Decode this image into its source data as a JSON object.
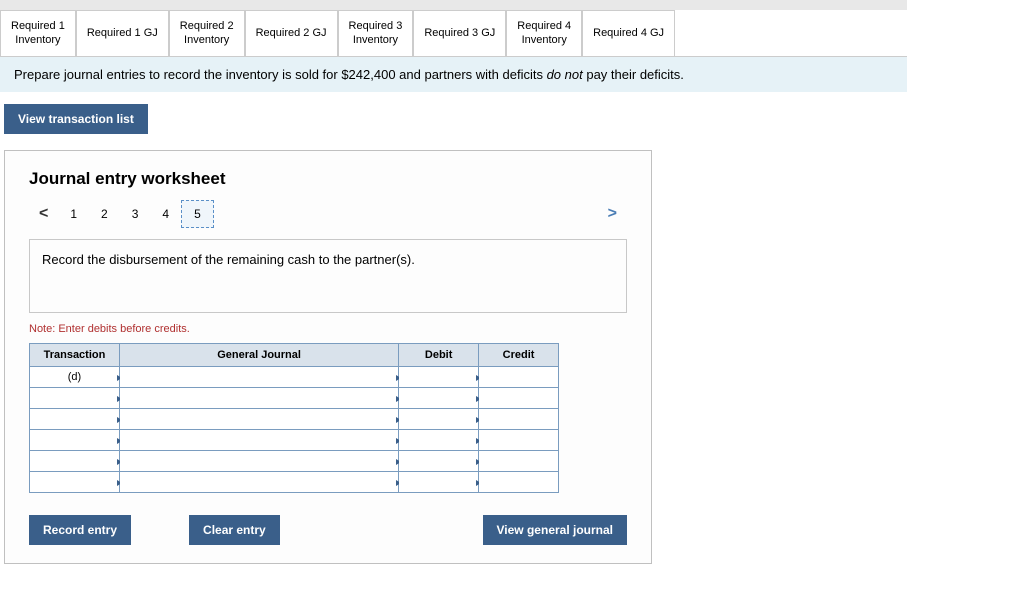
{
  "tabs": [
    {
      "line1": "Required 1",
      "line2": "Inventory"
    },
    {
      "label": "Required 1 GJ"
    },
    {
      "line1": "Required 2",
      "line2": "Inventory"
    },
    {
      "label": "Required 2 GJ"
    },
    {
      "line1": "Required 3",
      "line2": "Inventory"
    },
    {
      "label": "Required 3 GJ"
    },
    {
      "line1": "Required 4",
      "line2": "Inventory"
    },
    {
      "label": "Required 4 GJ"
    }
  ],
  "instruction": {
    "pre": "Prepare journal entries to record the inventory is sold for $242,400 and partners with deficits ",
    "em": "do not",
    "post": " pay their deficits."
  },
  "view_transaction_label": "View transaction list",
  "worksheet": {
    "title": "Journal entry worksheet",
    "pager": {
      "nums": [
        "1",
        "2",
        "3",
        "4",
        "5"
      ],
      "active": "5",
      "left": "<",
      "right": ">"
    },
    "prompt": "Record the disbursement of the remaining cash to the partner(s).",
    "note": "Note: Enter debits before credits.",
    "headers": {
      "transaction": "Transaction",
      "gj": "General Journal",
      "debit": "Debit",
      "credit": "Credit"
    },
    "first_transaction": "(d)",
    "rows": 6,
    "buttons": {
      "record": "Record entry",
      "clear": "Clear entry",
      "view_gj": "View general journal"
    }
  }
}
